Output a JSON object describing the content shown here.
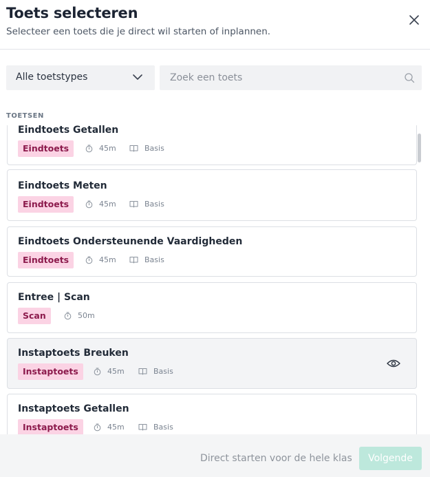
{
  "header": {
    "title": "Toets selecteren",
    "subtitle": "Selecteer een toets die je direct wil starten of inplannen."
  },
  "filters": {
    "type_value": "Alle toetstypes",
    "search_placeholder": "Zoek een toets"
  },
  "section_label": "TOETSEN",
  "tests": [
    {
      "name": "Eindtoets Getallen",
      "badge": "Eindtoets",
      "duration": "45m",
      "level": "Basis"
    },
    {
      "name": "Eindtoets Meten",
      "badge": "Eindtoets",
      "duration": "45m",
      "level": "Basis"
    },
    {
      "name": "Eindtoets Ondersteunende Vaardigheden",
      "badge": "Eindtoets",
      "duration": "45m",
      "level": "Basis"
    },
    {
      "name": "Entree | Scan",
      "badge": "Scan",
      "duration": "50m"
    },
    {
      "name": "Instaptoets Breuken",
      "badge": "Instaptoets",
      "duration": "45m",
      "level": "Basis"
    },
    {
      "name": "Instaptoets Getallen",
      "badge": "Instaptoets",
      "duration": "45m",
      "level": "Basis"
    }
  ],
  "footer": {
    "start_all": "Direct starten voor de hele klas",
    "next": "Volgende"
  },
  "colors": {
    "badge_bg": "#fbd3e4",
    "badge_text": "#8c1a4c",
    "primary_disabled": "#bde8dc"
  }
}
